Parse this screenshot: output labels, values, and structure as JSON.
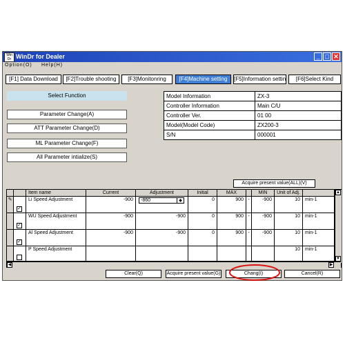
{
  "window": {
    "title": "WinDr for Dealer",
    "icon_text": "Win Dr",
    "controls": [
      "minimize-icon",
      "maximize-icon",
      "close-icon"
    ]
  },
  "menu": {
    "items": [
      "Option(O)",
      "Help(H)"
    ]
  },
  "tabs": [
    {
      "label": "[F1] Data Download",
      "active": false
    },
    {
      "label": "[F2]Trouble shooting",
      "active": false
    },
    {
      "label": "[F3]Monitonring",
      "active": false
    },
    {
      "label": "[F4]Machine setting",
      "active": true
    },
    {
      "label": "[F5]Information setting",
      "active": false
    },
    {
      "label": "[F6]Select Kind",
      "active": false
    }
  ],
  "functions": {
    "title": "Select Function",
    "buttons": [
      "Parameter Change(A)",
      "ATT Parameter Change(D)",
      "ML Parameter Change(F)",
      "All Parameter intialize(S)"
    ]
  },
  "machine_info": [
    {
      "label": "Model Information",
      "value": "ZX-3"
    },
    {
      "label": "Controller Information",
      "value": "Main C/U"
    },
    {
      "label": "Controller Ver.",
      "value": "01 00"
    },
    {
      "label": "Model(Model Code)",
      "value": "ZX200-3"
    },
    {
      "label": "S/N",
      "value": "000001"
    }
  ],
  "acquire_all_label": "Acquire present value(ALL)(V)",
  "table": {
    "headers": {
      "item": "Item name",
      "current": "Current",
      "adjustment": "Adjustment",
      "initial": "Initial",
      "max": "MAX",
      "min": "MIN",
      "unit": "Unit of Adj."
    },
    "rows": [
      {
        "checked": true,
        "item": "Li Speed Adjustment",
        "current": "-900",
        "adjustment": "-860",
        "initial": "0",
        "max": "900",
        "min": "-900",
        "step": "10",
        "unit": "min-1"
      },
      {
        "checked": true,
        "item": "WU Speed Adjustment",
        "current": "-900",
        "adjustment": "-900",
        "initial": "0",
        "max": "900",
        "min": "-900",
        "step": "10",
        "unit": "min-1"
      },
      {
        "checked": true,
        "item": "Al Speed Adjustment",
        "current": "-900",
        "adjustment": "-900",
        "initial": "0",
        "max": "900",
        "min": "-900",
        "step": "10",
        "unit": "min-1"
      },
      {
        "checked": false,
        "item": "P Speed Adjustment",
        "current": "",
        "adjustment": "",
        "initial": "",
        "max": "",
        "min": "",
        "step": "10",
        "unit": "min-1"
      }
    ]
  },
  "bottom_buttons": {
    "clear": "Clear(Q)",
    "acquire": "Acquire present value(G)",
    "change": "Chang(I)",
    "cancel": "Cancel(R)"
  },
  "colors": {
    "titlebar": "#2a55cc",
    "active_tab": "#3f7fd6",
    "highlight_circle": "#dd1111",
    "panel_title": "#c8e2ee"
  }
}
